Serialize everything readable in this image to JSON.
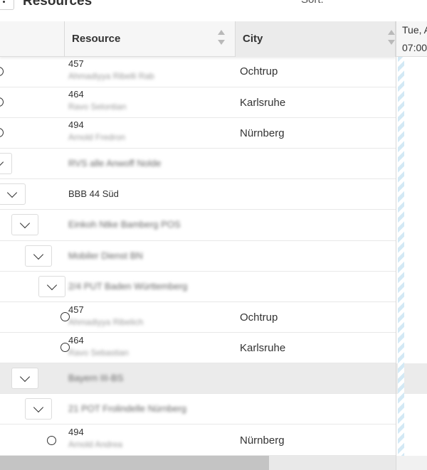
{
  "header": {
    "title": "Resources",
    "sort_label": "Sort:"
  },
  "columns": {
    "resource": "Resource",
    "city": "City"
  },
  "rows": [
    {
      "kind": "resource",
      "id": "457",
      "sub": "Ahmadiyya Ribelli Rab",
      "city": "Ochtrup"
    },
    {
      "kind": "resource",
      "id": "464",
      "sub": "Ravo Selontian",
      "city": "Karlsruhe"
    },
    {
      "kind": "resource",
      "id": "494",
      "sub": "Arnold Fredron",
      "city": "Nürnberg"
    },
    {
      "kind": "group",
      "name": "RVS alle Anwoff Nolde"
    },
    {
      "kind": "group",
      "name": "BBB 44 Süd"
    },
    {
      "kind": "group",
      "name": "Einkoh Ntke Bamberg POS"
    },
    {
      "kind": "group",
      "name": "Mobiler Dienst BN"
    },
    {
      "kind": "group",
      "name": "2/4 PUT Baden Württemberg"
    },
    {
      "kind": "resource",
      "id": "457",
      "sub": "Ahmadiyya Ribelich",
      "city": "Ochtrup"
    },
    {
      "kind": "resource",
      "id": "464",
      "sub": "Ravo Sebastian",
      "city": "Karlsruhe"
    },
    {
      "kind": "group",
      "name": "Bayern III-BS"
    },
    {
      "kind": "group",
      "name": "21 POT Frolindelle Nürnberg"
    },
    {
      "kind": "resource",
      "id": "494",
      "sub": "Arnold Andrea",
      "city": "Nürnberg"
    }
  ],
  "timeline": {
    "date": "Tue, A",
    "time": "07:00"
  },
  "colors": {
    "accent_stripe": "#d3e9f5",
    "selected_row": "#ebebeb"
  }
}
